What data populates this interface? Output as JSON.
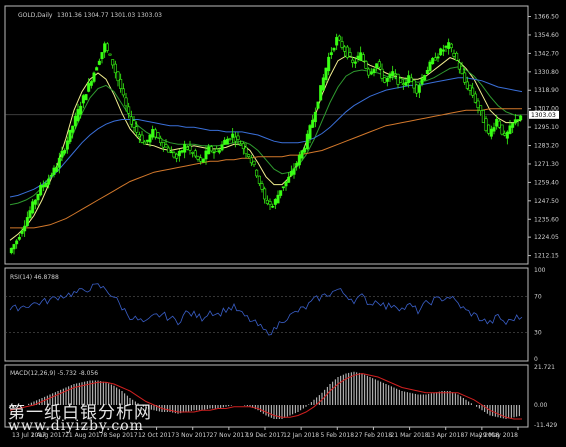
{
  "header": {
    "symbol_label": "GOLD,Daily",
    "ohlc_label": "1301.36 1304.77 1301.03 1303.03"
  },
  "rsi_label": "RSI(14) 46.8788",
  "macd_label": "MACD(12,26,9) -5.732 -8.056",
  "watermark": {
    "line1": "第一纸白银分析网",
    "line2": "www.diyizby.com"
  },
  "colors": {
    "background": "#000000",
    "frame": "#bdbdbd",
    "bull_candle": "#39ff14",
    "bear_candle": "#000000",
    "ma_fast": "#f2ef8f",
    "ma_mid": "#2f9a2f",
    "ma_slow_blue": "#3a6fd8",
    "ma_long_orange": "#d2782b",
    "rsi_line": "#3a5fc8",
    "macd_hist": "#cfcfcf",
    "macd_signal": "#d02020",
    "text": "#d0d0d0"
  },
  "chart_data": [
    {
      "type": "candlestick",
      "title": "GOLD,Daily",
      "y_axis_ticks": [
        1366.5,
        1354.6,
        1342.7,
        1330.8,
        1318.9,
        1307.0,
        1295.1,
        1283.2,
        1271.3,
        1259.4,
        1247.5,
        1235.6,
        1224.05,
        1212.15
      ],
      "y_axis_labels": [
        "1366.50",
        "1354.60",
        "1342.70",
        "1330.80",
        "1318.90",
        "1307.00",
        "1295.10",
        "1283.20",
        "1271.30",
        "1259.40",
        "1247.50",
        "1235.60",
        "1224.05",
        "1212.15"
      ],
      "ylim": [
        1208,
        1372
      ],
      "current_price_label": "1303.03",
      "current_price": 1303.03,
      "x_axis_labels": [
        "13 Jul 2017",
        "1 Aug 2017",
        "21 Aug 2017",
        "8 Sep 2017",
        "12 Oct 2017",
        "3 Nov 2017",
        "27 Nov 2017",
        "19 Dec 2017",
        "12 Jan 2018",
        "5 Feb 2018",
        "27 Feb 2018",
        "21 Mar 2018",
        "13 Apr 2018",
        "7 May 2018",
        "29 May 2018"
      ],
      "close_path": [
        1214,
        1222,
        1233,
        1245,
        1256,
        1262,
        1270,
        1282,
        1296,
        1310,
        1322,
        1335,
        1348,
        1336,
        1320,
        1302,
        1292,
        1284,
        1292,
        1286,
        1280,
        1275,
        1283,
        1278,
        1272,
        1281,
        1279,
        1286,
        1290,
        1284,
        1277,
        1265,
        1248,
        1244,
        1255,
        1262,
        1272,
        1283,
        1300,
        1320,
        1340,
        1352,
        1345,
        1336,
        1342,
        1330,
        1336,
        1324,
        1330,
        1322,
        1327,
        1319,
        1330,
        1338,
        1344,
        1348,
        1338,
        1324,
        1316,
        1304,
        1290,
        1300,
        1288,
        1297,
        1303
      ],
      "moving_averages": [
        {
          "color_key": "ma_fast",
          "path": [
            1222,
            1226,
            1231,
            1238,
            1248,
            1260,
            1272,
            1288,
            1306,
            1318,
            1326,
            1330,
            1326,
            1316,
            1304,
            1294,
            1288,
            1284,
            1283,
            1281,
            1280,
            1281,
            1282,
            1283,
            1282,
            1281,
            1281,
            1282,
            1284,
            1284,
            1280,
            1272,
            1263,
            1258,
            1258,
            1263,
            1272,
            1285,
            1300,
            1316,
            1328,
            1338,
            1341,
            1340,
            1338,
            1335,
            1333,
            1330,
            1328,
            1327,
            1326,
            1326,
            1328,
            1332,
            1336,
            1340,
            1338,
            1333,
            1326,
            1316,
            1306,
            1301,
            1298,
            1298,
            1300
          ]
        },
        {
          "color_key": "ma_mid",
          "path": [
            1245,
            1246,
            1248,
            1251,
            1256,
            1263,
            1270,
            1280,
            1292,
            1304,
            1314,
            1320,
            1322,
            1318,
            1310,
            1302,
            1296,
            1292,
            1289,
            1287,
            1285,
            1284,
            1284,
            1284,
            1283,
            1283,
            1283,
            1284,
            1285,
            1286,
            1284,
            1280,
            1274,
            1268,
            1265,
            1266,
            1270,
            1277,
            1287,
            1299,
            1311,
            1321,
            1328,
            1331,
            1332,
            1331,
            1330,
            1328,
            1327,
            1326,
            1325,
            1324,
            1325,
            1327,
            1330,
            1333,
            1334,
            1332,
            1328,
            1322,
            1315,
            1309,
            1305,
            1303,
            1302
          ]
        },
        {
          "color_key": "ma_slow_blue",
          "path": [
            1250,
            1251,
            1253,
            1255,
            1258,
            1262,
            1267,
            1273,
            1279,
            1285,
            1290,
            1294,
            1297,
            1299,
            1300,
            1300,
            1300,
            1299,
            1298,
            1297,
            1296,
            1296,
            1295,
            1295,
            1294,
            1293,
            1293,
            1292,
            1292,
            1292,
            1291,
            1290,
            1288,
            1286,
            1285,
            1285,
            1285,
            1286,
            1288,
            1291,
            1295,
            1300,
            1305,
            1309,
            1312,
            1315,
            1317,
            1319,
            1320,
            1321,
            1322,
            1322,
            1323,
            1324,
            1325,
            1326,
            1327,
            1327,
            1326,
            1325,
            1323,
            1321,
            1320,
            1319,
            1318
          ]
        },
        {
          "color_key": "ma_long_orange",
          "path": [
            1230,
            1230,
            1230,
            1230,
            1231,
            1232,
            1234,
            1236,
            1239,
            1242,
            1245,
            1248,
            1251,
            1254,
            1257,
            1260,
            1262,
            1264,
            1266,
            1267,
            1268,
            1269,
            1270,
            1271,
            1272,
            1273,
            1273,
            1274,
            1274,
            1275,
            1275,
            1276,
            1276,
            1276,
            1276,
            1277,
            1277,
            1278,
            1279,
            1280,
            1282,
            1284,
            1286,
            1288,
            1290,
            1292,
            1294,
            1296,
            1297,
            1298,
            1299,
            1300,
            1301,
            1302,
            1303,
            1304,
            1305,
            1306,
            1306,
            1306,
            1307,
            1307,
            1307,
            1307,
            1307
          ]
        }
      ]
    },
    {
      "type": "line",
      "title": "RSI(14) 46.8788",
      "y_axis_labels": [
        "100",
        "70",
        "30",
        "0"
      ],
      "y_axis_ticks": [
        100,
        70,
        30,
        0
      ],
      "ylim": [
        0,
        100
      ],
      "values": [
        55,
        58,
        60,
        62,
        64,
        66,
        70,
        72,
        74,
        76,
        80,
        82,
        78,
        70,
        58,
        48,
        44,
        40,
        48,
        50,
        46,
        42,
        52,
        50,
        46,
        54,
        50,
        56,
        58,
        50,
        44,
        38,
        30,
        32,
        44,
        48,
        54,
        58,
        66,
        70,
        74,
        78,
        72,
        66,
        70,
        62,
        66,
        58,
        62,
        56,
        60,
        54,
        62,
        66,
        68,
        70,
        62,
        54,
        50,
        44,
        40,
        48,
        40,
        46,
        47
      ]
    },
    {
      "type": "bar",
      "title": "MACD(12,26,9) -5.732 -8.056",
      "y_axis_labels": [
        "21.721",
        "0.00",
        "-11.429"
      ],
      "y_axis_ticks": [
        21.721,
        0,
        -11.429
      ],
      "ylim": [
        -11.429,
        21.721
      ],
      "histogram": [
        -2,
        -1,
        0,
        2,
        4,
        6,
        8,
        10,
        12,
        13,
        14,
        14,
        13,
        11,
        8,
        4,
        1,
        -2,
        -3,
        -4,
        -4,
        -5,
        -4,
        -3,
        -3,
        -2,
        -2,
        -1,
        0,
        0,
        -1,
        -3,
        -6,
        -8,
        -8,
        -6,
        -4,
        -1,
        3,
        7,
        12,
        16,
        18,
        19,
        18,
        16,
        14,
        12,
        10,
        8,
        7,
        6,
        6,
        7,
        8,
        8,
        6,
        3,
        0,
        -3,
        -6,
        -7,
        -8,
        -7,
        -6
      ],
      "signal": [
        -3,
        -2,
        -1,
        0,
        2,
        4,
        6,
        8,
        10,
        11,
        12,
        13,
        13,
        12,
        10,
        8,
        5,
        2,
        0,
        -2,
        -3,
        -4,
        -4,
        -4,
        -3,
        -3,
        -2,
        -2,
        -1,
        -1,
        -1,
        -2,
        -4,
        -6,
        -7,
        -7,
        -6,
        -4,
        -1,
        3,
        8,
        12,
        15,
        17,
        18,
        17,
        16,
        14,
        12,
        10,
        9,
        8,
        7,
        7,
        7,
        7,
        7,
        5,
        3,
        0,
        -3,
        -5,
        -7,
        -8,
        -8
      ]
    }
  ]
}
